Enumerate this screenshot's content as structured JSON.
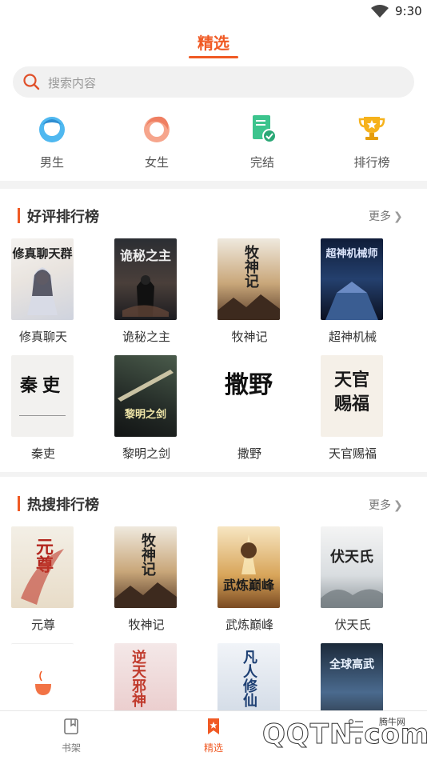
{
  "status": {
    "time": "9:30"
  },
  "header": {
    "title": "精选"
  },
  "search": {
    "placeholder": "搜索内容"
  },
  "categories": [
    {
      "label": "男生",
      "icon": "male-avatar-icon"
    },
    {
      "label": "女生",
      "icon": "female-avatar-icon"
    },
    {
      "label": "完结",
      "icon": "completed-book-icon"
    },
    {
      "label": "排行榜",
      "icon": "trophy-icon"
    }
  ],
  "sections": [
    {
      "title": "好评排行榜",
      "more": "更多",
      "books": [
        {
          "name": "修真聊天",
          "cover_text": "修真聊天群"
        },
        {
          "name": "诡秘之主",
          "cover_text": "诡秘之主"
        },
        {
          "name": "牧神记",
          "cover_text": "牧神记"
        },
        {
          "name": "超神机械",
          "cover_text": "超神机械师"
        },
        {
          "name": "秦吏",
          "cover_text": "秦吏"
        },
        {
          "name": "黎明之剑",
          "cover_text": "黎明之剑"
        },
        {
          "name": "撒野",
          "cover_text": "撒野"
        },
        {
          "name": "天官赐福",
          "cover_text": "天官赐福"
        }
      ]
    },
    {
      "title": "热搜排行榜",
      "more": "更多",
      "books": [
        {
          "name": "元尊",
          "cover_text": "元尊"
        },
        {
          "name": "牧神记",
          "cover_text": "牧神记"
        },
        {
          "name": "武炼巅峰",
          "cover_text": "武炼巅峰"
        },
        {
          "name": "伏天氏",
          "cover_text": "伏天氏"
        },
        {
          "name": "",
          "cover_text": ""
        },
        {
          "name": "",
          "cover_text": "逆天邪神"
        },
        {
          "name": "",
          "cover_text": "凡人修仙"
        },
        {
          "name": "",
          "cover_text": "全球高武"
        }
      ]
    }
  ],
  "tabbar": [
    {
      "label": "书架",
      "icon": "bookshelf-icon"
    },
    {
      "label": "精选",
      "icon": "star-bookmark-icon"
    },
    {
      "label": "",
      "icon": "list-icon"
    }
  ],
  "watermark": {
    "text": "QQTN.com",
    "sub": "腾牛网"
  },
  "colors": {
    "accent": "#f05a24",
    "gap": "#f3f3f3"
  }
}
